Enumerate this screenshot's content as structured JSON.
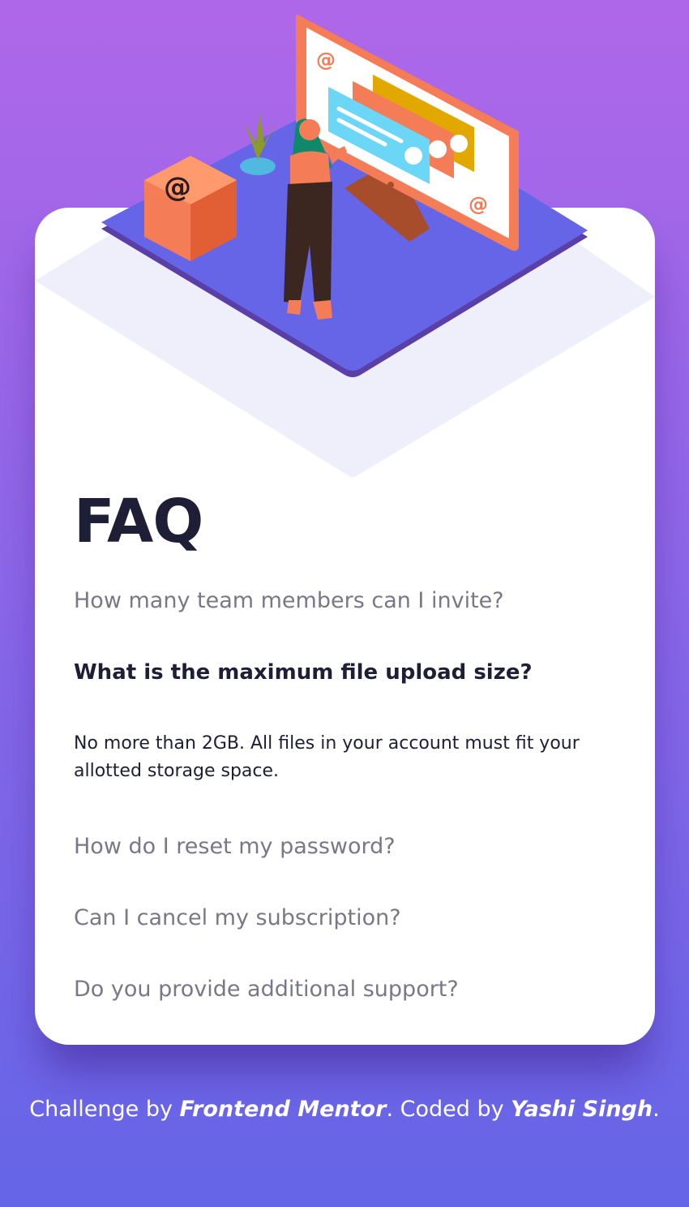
{
  "page": {
    "title": "FAQ"
  },
  "faq": {
    "items": [
      {
        "question": "How many team members can I invite?"
      },
      {
        "question": "What is the maximum file upload size?",
        "answer": "No more than 2GB. All files in your account must fit your allotted storage space."
      },
      {
        "question": "How do I reset my password?"
      },
      {
        "question": "Can I cancel my subscription?"
      },
      {
        "question": "Do you provide additional support?"
      }
    ]
  },
  "attribution": {
    "prefix": "Challenge by",
    "link1": "Frontend Mentor",
    "middle": ". Coded by",
    "link2": "Yashi Singh",
    "suffix": "."
  },
  "colors": {
    "bg_top": "#af67e9",
    "bg_bottom": "#6565e7",
    "heading": "#1e1f36",
    "question": "#787887",
    "card": "#ffffff",
    "accent_orange": "#f47c57"
  },
  "icons": [
    "at-sign-icon",
    "woman-figure",
    "monitor-icon",
    "plant-icon",
    "box-icon"
  ]
}
